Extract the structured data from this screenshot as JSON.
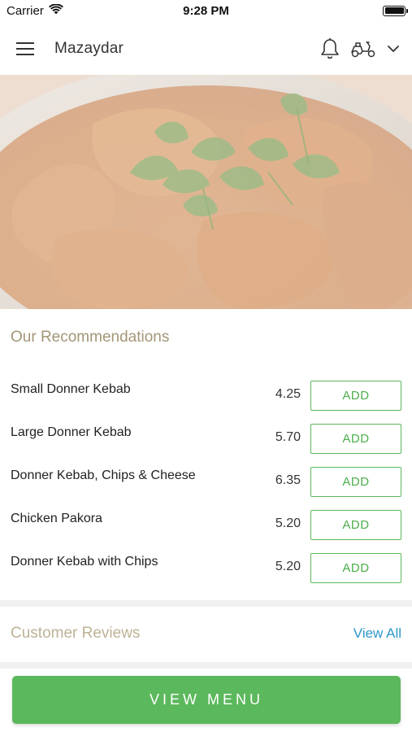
{
  "status_bar": {
    "carrier": "Carrier",
    "time": "9:28 PM"
  },
  "header": {
    "title": "Mazaydar",
    "menu_icon": "hamburger-icon",
    "notification_icon": "bell-icon",
    "delivery_icon": "scooter-icon",
    "dropdown_icon": "chevron-down-icon"
  },
  "hero": {
    "image": "curry-dish-photo"
  },
  "recommendations": {
    "title": "Our Recommendations",
    "items": [
      {
        "name": "Small Donner Kebab",
        "price": "4.25",
        "action": "ADD"
      },
      {
        "name": "Large Donner Kebab",
        "price": "5.70",
        "action": "ADD"
      },
      {
        "name": "Donner Kebab, Chips & Cheese",
        "price": "6.35",
        "action": "ADD"
      },
      {
        "name": "Chicken Pakora",
        "price": "5.20",
        "action": "ADD"
      },
      {
        "name": "Donner Kebab with Chips",
        "price": "5.20",
        "action": "ADD"
      }
    ]
  },
  "reviews": {
    "title": "Customer Reviews",
    "view_all": "View All"
  },
  "footer": {
    "cta": "VIEW MENU"
  },
  "colors": {
    "accent_green": "#5cb85c",
    "section_title": "#a39677",
    "link_blue": "#2e98c8"
  }
}
